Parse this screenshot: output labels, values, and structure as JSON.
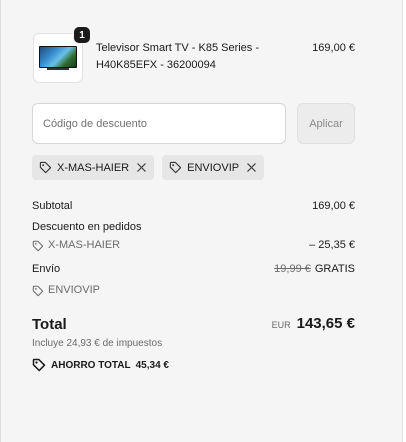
{
  "product": {
    "quantity": "1",
    "title": "Televisor Smart TV - K85 Series - H40K85EFX - 36200094",
    "price": "169,00 €",
    "image_icon": "tv-thumbnail"
  },
  "discount": {
    "placeholder": "Código de descuento",
    "value": "",
    "apply_label": "Aplicar"
  },
  "tags": [
    {
      "code": "X-MAS-HAIER",
      "icon": "tag-icon",
      "remove_icon": "close-icon"
    },
    {
      "code": "ENVIOVIP",
      "icon": "tag-icon",
      "remove_icon": "close-icon"
    }
  ],
  "summary": {
    "subtotal_label": "Subtotal",
    "subtotal_value": "169,00 €",
    "order_discount_label": "Descuento en pedidos",
    "order_discount_code": "X-MAS-HAIER",
    "order_discount_value": "– 25,35 €",
    "shipping_label": "Envío",
    "shipping_original": "19,99 €",
    "shipping_value": "GRATIS",
    "shipping_code": "ENVIOVIP"
  },
  "total": {
    "label": "Total",
    "currency": "EUR",
    "amount": "143,65 €",
    "taxes": "Incluye 24,93 € de impuestos",
    "savings_label": "AHORRO TOTAL",
    "savings_value": "45,34 €"
  }
}
